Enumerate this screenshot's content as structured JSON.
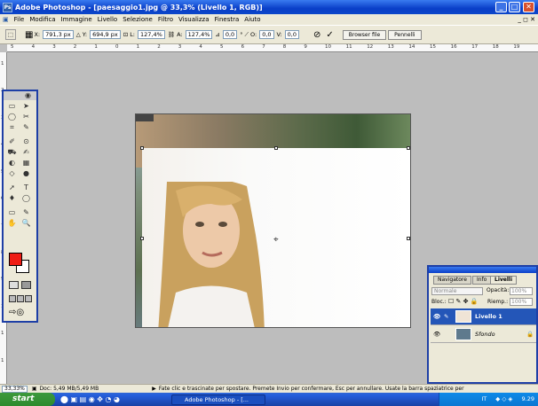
{
  "window": {
    "title": "Adobe Photoshop - [paesaggio1.jpg @ 33,3% (Livello 1, RGB)]",
    "controls": {
      "minimize": "_",
      "maximize": "□",
      "close": "✕"
    },
    "doc_controls": "_ ◻ ✕"
  },
  "menu": [
    "File",
    "Modifica",
    "Immagine",
    "Livello",
    "Selezione",
    "Filtro",
    "Visualizza",
    "Finestra",
    "Aiuto"
  ],
  "options": {
    "x_label": "X:",
    "x_value": "791,3 px",
    "y_label": "Y:",
    "y_value": "694,9 px",
    "w_label": "L:",
    "w_value": "127,4%",
    "h_label": "A:",
    "h_value": "127,4%",
    "angle_value": "0,0",
    "angle_unit": "°",
    "h_skew_label": "O:",
    "h_skew_value": "0,0",
    "v_skew_label": "V:",
    "v_skew_value": "0,0",
    "cancel_icon": "⊘",
    "confirm_icon": "✓",
    "tab_browser": "Browser file",
    "tab_brushes": "Pennelli"
  },
  "ruler_top": [
    "5",
    "4",
    "3",
    "2",
    "1",
    "0",
    "1",
    "2",
    "3",
    "4",
    "5",
    "6",
    "7",
    "8",
    "9",
    "10",
    "11",
    "12",
    "13",
    "14",
    "15",
    "16",
    "17",
    "18",
    "19"
  ],
  "ruler_left": [
    "1",
    "2",
    "3",
    "4",
    "5",
    "6",
    "7",
    "8",
    "9",
    "1",
    "1",
    "1"
  ],
  "tools": [
    "▭",
    "➤",
    "◯",
    "✂",
    "⌗",
    "✎",
    "✐",
    "⊙",
    "⛟",
    "✍",
    "◐",
    "▦",
    "◇",
    "●",
    "➚",
    "T",
    "♦",
    "◯",
    "▭",
    "✎",
    "✋",
    "🔍"
  ],
  "colors": {
    "accent": "#0a3fc8",
    "foreground": "#ee1c14",
    "background": "#ffffff"
  },
  "layers_panel": {
    "tabs": [
      "Navigatore",
      "Info",
      "Livelli"
    ],
    "blend_mode": "Normale",
    "opacity_label": "Opacità:",
    "opacity_value": "100%",
    "lock_label": "Bloc.:",
    "fill_label": "Riemp.:",
    "fill_value": "100%",
    "layers": [
      {
        "name": "Livello 1",
        "selected": true
      },
      {
        "name": "Sfondo",
        "selected": false
      }
    ]
  },
  "status": {
    "zoom": "33,33%",
    "doc": "Doc: 5,49 MB/5,49 MB",
    "hint": "Fate clic e trascinate per spostare. Premete Invio per confermare, Esc per annullare. Usate la barra spaziatrice per"
  },
  "taskbar": {
    "start": "start",
    "item": "Adobe Photoshop - [...",
    "lang": "IT",
    "clock": "9.29"
  }
}
